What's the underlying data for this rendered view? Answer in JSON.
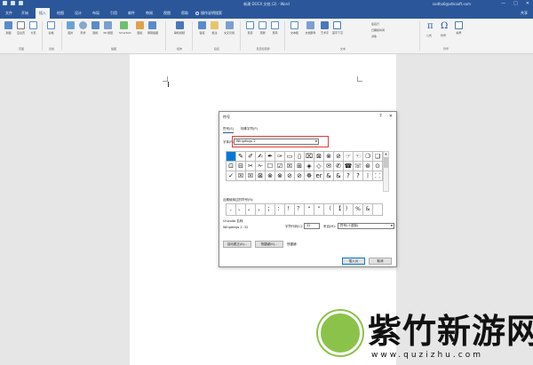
{
  "window": {
    "title": "新建 DOCX 文档 (2) - Word",
    "user": "sodha6@xhksoft.com",
    "controls": [
      "—",
      "□",
      "✕"
    ]
  },
  "ribbon_tabs": [
    {
      "label": "文件",
      "active": false
    },
    {
      "label": "开始",
      "active": false
    },
    {
      "label": "插入",
      "active": true
    },
    {
      "label": "绘图",
      "active": false
    },
    {
      "label": "设计",
      "active": false
    },
    {
      "label": "布局",
      "active": false
    },
    {
      "label": "引用",
      "active": false
    },
    {
      "label": "邮件",
      "active": false
    },
    {
      "label": "审阅",
      "active": false
    },
    {
      "label": "视图",
      "active": false
    },
    {
      "label": "帮助",
      "active": false
    }
  ],
  "tell_me": "操作说明搜索",
  "share": "共享",
  "ribbon_groups": {
    "pages": {
      "label": "页面",
      "buttons": [
        "封面",
        "空白页",
        "分页"
      ]
    },
    "tables": {
      "label": "表格",
      "buttons": [
        "表格"
      ]
    },
    "illustrations": {
      "label": "插图",
      "buttons": [
        "图片",
        "形状",
        "图标",
        "3D 模型",
        "SmartArt",
        "图表",
        "屏幕截图"
      ]
    },
    "media": {
      "label": "媒体",
      "buttons": [
        "联机视频"
      ]
    },
    "links": {
      "label": "链接",
      "buttons": [
        "链接",
        "批注",
        "交叉引用"
      ]
    },
    "header_footer": {
      "label": "页眉和页脚",
      "buttons": [
        "页眉",
        "页脚",
        "页码"
      ]
    },
    "text": {
      "label": "文本",
      "buttons": [
        "文本框",
        "文档部件",
        "艺术字",
        "首字下沉"
      ],
      "small": [
        "签名行",
        "日期和时间",
        "对象"
      ]
    },
    "symbols": {
      "label": "符号",
      "buttons": [
        "公式",
        "符号",
        "编号"
      ]
    }
  },
  "dialog": {
    "title": "符号",
    "controls": [
      "?",
      "✕"
    ],
    "tabs": [
      "符号(S)",
      "特殊字符(P)"
    ],
    "font_label": "字体(F):",
    "font_value": "Wingdings 2",
    "symbols": [
      "",
      "✎",
      "✐",
      "✍",
      "✒",
      "✑",
      "▭",
      "▯",
      "⌧",
      "⊠",
      "⊗",
      "⊘",
      "☞",
      "☜",
      "❍",
      "❏",
      "⊡",
      "⊟",
      "✂",
      "✁",
      "☐",
      "☑",
      "☒",
      "⊞",
      "◈",
      "◇",
      "✉",
      "✆",
      "☎",
      "☏",
      "⊛",
      "⊙",
      "✓",
      "☒",
      "☒",
      "⊠",
      "⊗",
      "⊗",
      "⊘",
      "⊘",
      "☸",
      "er",
      "&",
      "&",
      "?",
      "?",
      "⁞",
      "⸬"
    ],
    "recent_label": "近期使用过的符号(R):",
    "recent": [
      ",",
      "、",
      "。",
      "，",
      "；",
      "：",
      "！",
      "？",
      "“",
      "”",
      "（",
      "【",
      "）",
      "%",
      "&",
      ""
    ],
    "unicode_name_label": "Unicode 名称:",
    "unicode_name": "Wingdings 2: 32",
    "char_code_label": "字符代码(C):",
    "char_code": "32",
    "from_label": "来自(M):",
    "from_value": "符号(十进制)",
    "autocorrect_btn": "自动更正(A)...",
    "shortcut_btn": "快捷键(K)...",
    "shortcut_text": "快捷键:",
    "insert_btn": "插入(I)",
    "cancel_btn": "取消"
  },
  "watermark": {
    "text": "紫竹新游网",
    "url": "www.quzizhu.com"
  },
  "colors": {
    "accent": "#2b579a",
    "selection": "#0078d7",
    "highlight": "#e53935",
    "logo": "#8bc34a"
  }
}
